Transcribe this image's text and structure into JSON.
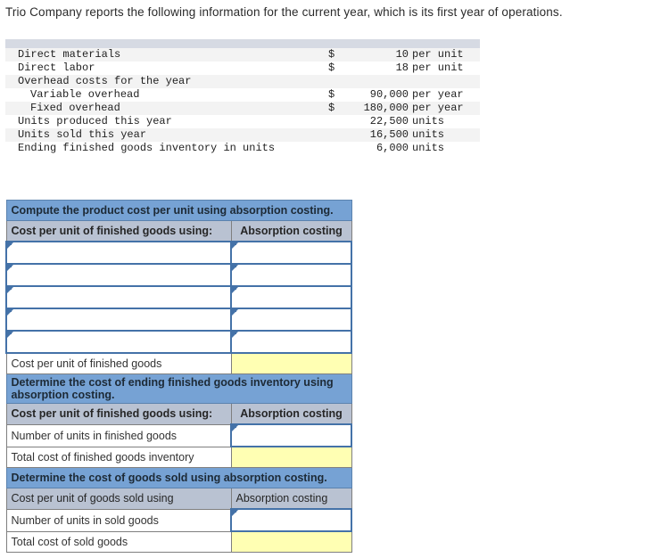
{
  "prompt": "Trio Company reports the following information for the current year, which is its first year of operations.",
  "info_table": {
    "rows": [
      {
        "label": "Direct materials",
        "indent": false,
        "symbol": "$",
        "amount": "10",
        "unit": "per unit"
      },
      {
        "label": "Direct labor",
        "indent": false,
        "symbol": "$",
        "amount": "18",
        "unit": "per unit"
      },
      {
        "label": "Overhead costs for the year",
        "indent": false,
        "symbol": "",
        "amount": "",
        "unit": ""
      },
      {
        "label": "Variable overhead",
        "indent": true,
        "symbol": "$",
        "amount": "90,000",
        "unit": "per year"
      },
      {
        "label": "Fixed overhead",
        "indent": true,
        "symbol": "$",
        "amount": "180,000",
        "unit": "per year"
      },
      {
        "label": "Units produced this year",
        "indent": false,
        "symbol": "",
        "amount": "22,500",
        "unit": "units"
      },
      {
        "label": "Units sold this year",
        "indent": false,
        "symbol": "",
        "amount": "16,500",
        "unit": "units"
      },
      {
        "label": "Ending finished goods inventory in units",
        "indent": false,
        "symbol": "",
        "amount": "6,000",
        "unit": "units"
      }
    ]
  },
  "worksheet": {
    "section1": {
      "banner": "Compute the product cost per unit using absorption costing.",
      "subhead_label": "Cost per unit of finished goods using:",
      "subhead_value": "Absorption costing",
      "entry_rows": [
        {
          "label": "",
          "value": ""
        },
        {
          "label": "",
          "value": ""
        },
        {
          "label": "",
          "value": ""
        },
        {
          "label": "",
          "value": ""
        },
        {
          "label": "",
          "value": ""
        }
      ],
      "total_label": "Cost per unit of finished goods",
      "total_value": ""
    },
    "section2": {
      "banner": "Determine the cost of ending finished goods inventory using absorption costing.",
      "subhead_label": "Cost per unit of finished goods using:",
      "subhead_value": "Absorption costing",
      "units_label": "Number of units in finished goods",
      "units_value": "",
      "total_label": "Total cost of finished goods inventory",
      "total_value": ""
    },
    "section3": {
      "banner": "Determine the cost of goods sold using absorption costing.",
      "subhead_label": "Cost per unit of goods sold using",
      "subhead_value": "Absorption costing",
      "units_label": "Number of units in sold goods",
      "units_value": "",
      "total_label": "Total cost of sold goods",
      "total_value": ""
    }
  },
  "colors": {
    "banner_blue": "#76a2d4",
    "subhead_gray": "#b9c2d2",
    "input_border_blue": "#4472a8",
    "computed_yellow": "#ffffb3",
    "info_band_gray": "#d6dae3",
    "info_stripe_gray": "#f3f3f3"
  }
}
